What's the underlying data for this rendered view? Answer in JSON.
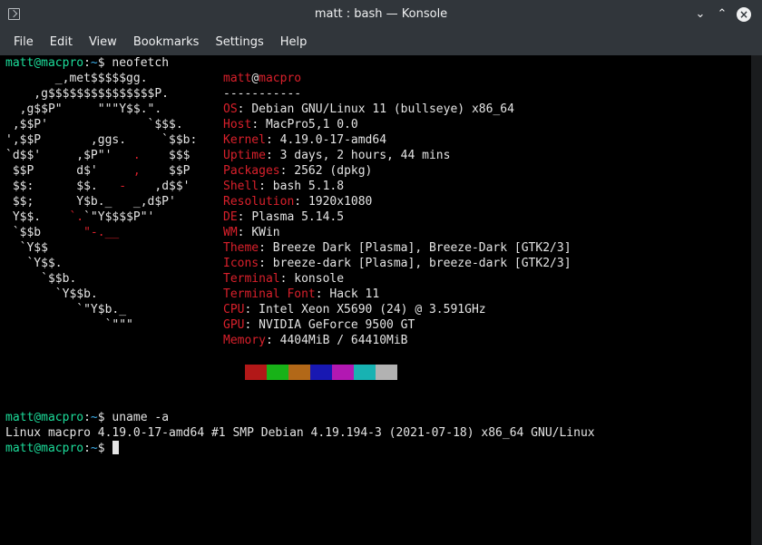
{
  "window": {
    "title": "matt : bash — Konsole"
  },
  "menu": [
    "File",
    "Edit",
    "View",
    "Bookmarks",
    "Settings",
    "Help"
  ],
  "prompt": {
    "user_host": "matt@macpro",
    "sep": ":",
    "path": "~",
    "suffix": "$ "
  },
  "commands": [
    "neofetch",
    "uname -a",
    ""
  ],
  "logo_lines": [
    "       _,met$$$$$gg.",
    "    ,g$$$$$$$$$$$$$$$P.",
    "  ,g$$P\"     \"\"\"Y$$.\".",
    " ,$$P'              `$$$.",
    "',$$P       ,ggs.     `$$b:",
    "`d$$'     ,$P\"'   .    $$$",
    " $$P      d$'     ,    $$P",
    " $$:      $$.   -    ,d$$'",
    " $$;      Y$b._   _,d$P'",
    " Y$$.    `.`\"Y$$$$P\"'",
    " `$$b      \"-.__",
    "  `Y$$",
    "   `Y$$.",
    "     `$$b.",
    "       `Y$$b.",
    "          `\"Y$b._",
    "              `\"\"\""
  ],
  "info": {
    "user": "matt",
    "at": "@",
    "host": "macpro",
    "underline": "-----------",
    "rows": [
      {
        "key": "OS",
        "value": "Debian GNU/Linux 11 (bullseye) x86_64"
      },
      {
        "key": "Host",
        "value": "MacPro5,1 0.0"
      },
      {
        "key": "Kernel",
        "value": "4.19.0-17-amd64"
      },
      {
        "key": "Uptime",
        "value": "3 days, 2 hours, 44 mins"
      },
      {
        "key": "Packages",
        "value": "2562 (dpkg)"
      },
      {
        "key": "Shell",
        "value": "bash 5.1.8"
      },
      {
        "key": "Resolution",
        "value": "1920x1080"
      },
      {
        "key": "DE",
        "value": "Plasma 5.14.5"
      },
      {
        "key": "WM",
        "value": "KWin"
      },
      {
        "key": "Theme",
        "value": "Breeze Dark [Plasma], Breeze-Dark [GTK2/3]"
      },
      {
        "key": "Icons",
        "value": "breeze-dark [Plasma], breeze-dark [GTK2/3]"
      },
      {
        "key": "Terminal",
        "value": "konsole"
      },
      {
        "key": "Terminal Font",
        "value": "Hack 11"
      },
      {
        "key": "CPU",
        "value": "Intel Xeon X5690 (24) @ 3.591GHz"
      },
      {
        "key": "GPU",
        "value": "NVIDIA GeForce 9500 GT"
      },
      {
        "key": "Memory",
        "value": "4404MiB / 64410MiB"
      }
    ],
    "palette": [
      "#b21818",
      "#18b218",
      "#b26818",
      "#1818b2",
      "#b218b2",
      "#18b2b2",
      "#b2b2b2"
    ]
  },
  "uname_output": "Linux macpro 4.19.0-17-amd64 #1 SMP Debian 4.19.194-3 (2021-07-18) x86_64 GNU/Linux",
  "colors": {
    "prompt_user": "#1cdc9a",
    "prompt_path": "#3daee9",
    "accent_red": "#d9202b",
    "titlebar": "#31363b"
  }
}
